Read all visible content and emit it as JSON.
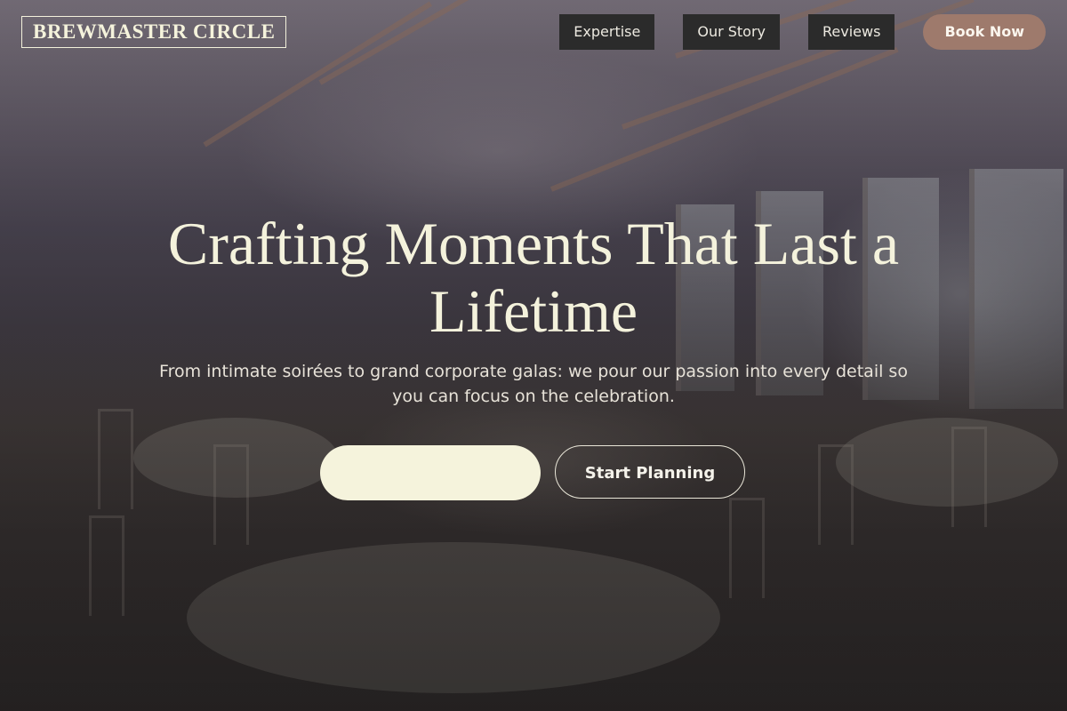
{
  "brand": {
    "name": "BREWMASTER CIRCLE"
  },
  "nav": {
    "links": [
      {
        "label": "Expertise"
      },
      {
        "label": "Our Story"
      },
      {
        "label": "Reviews"
      }
    ],
    "book_label": "Book Now"
  },
  "hero": {
    "headline": "Crafting Moments That Last a Lifetime",
    "subtext": "From intimate soirées to grand corporate galas: we pour our passion into every detail so you can focus on the celebration.",
    "primary_cta_label": "",
    "secondary_cta_label": "Start Planning"
  },
  "colors": {
    "cream": "#f5f3dc",
    "accent": "#9e7a6c",
    "nav_bg": "#2b2b2b"
  }
}
